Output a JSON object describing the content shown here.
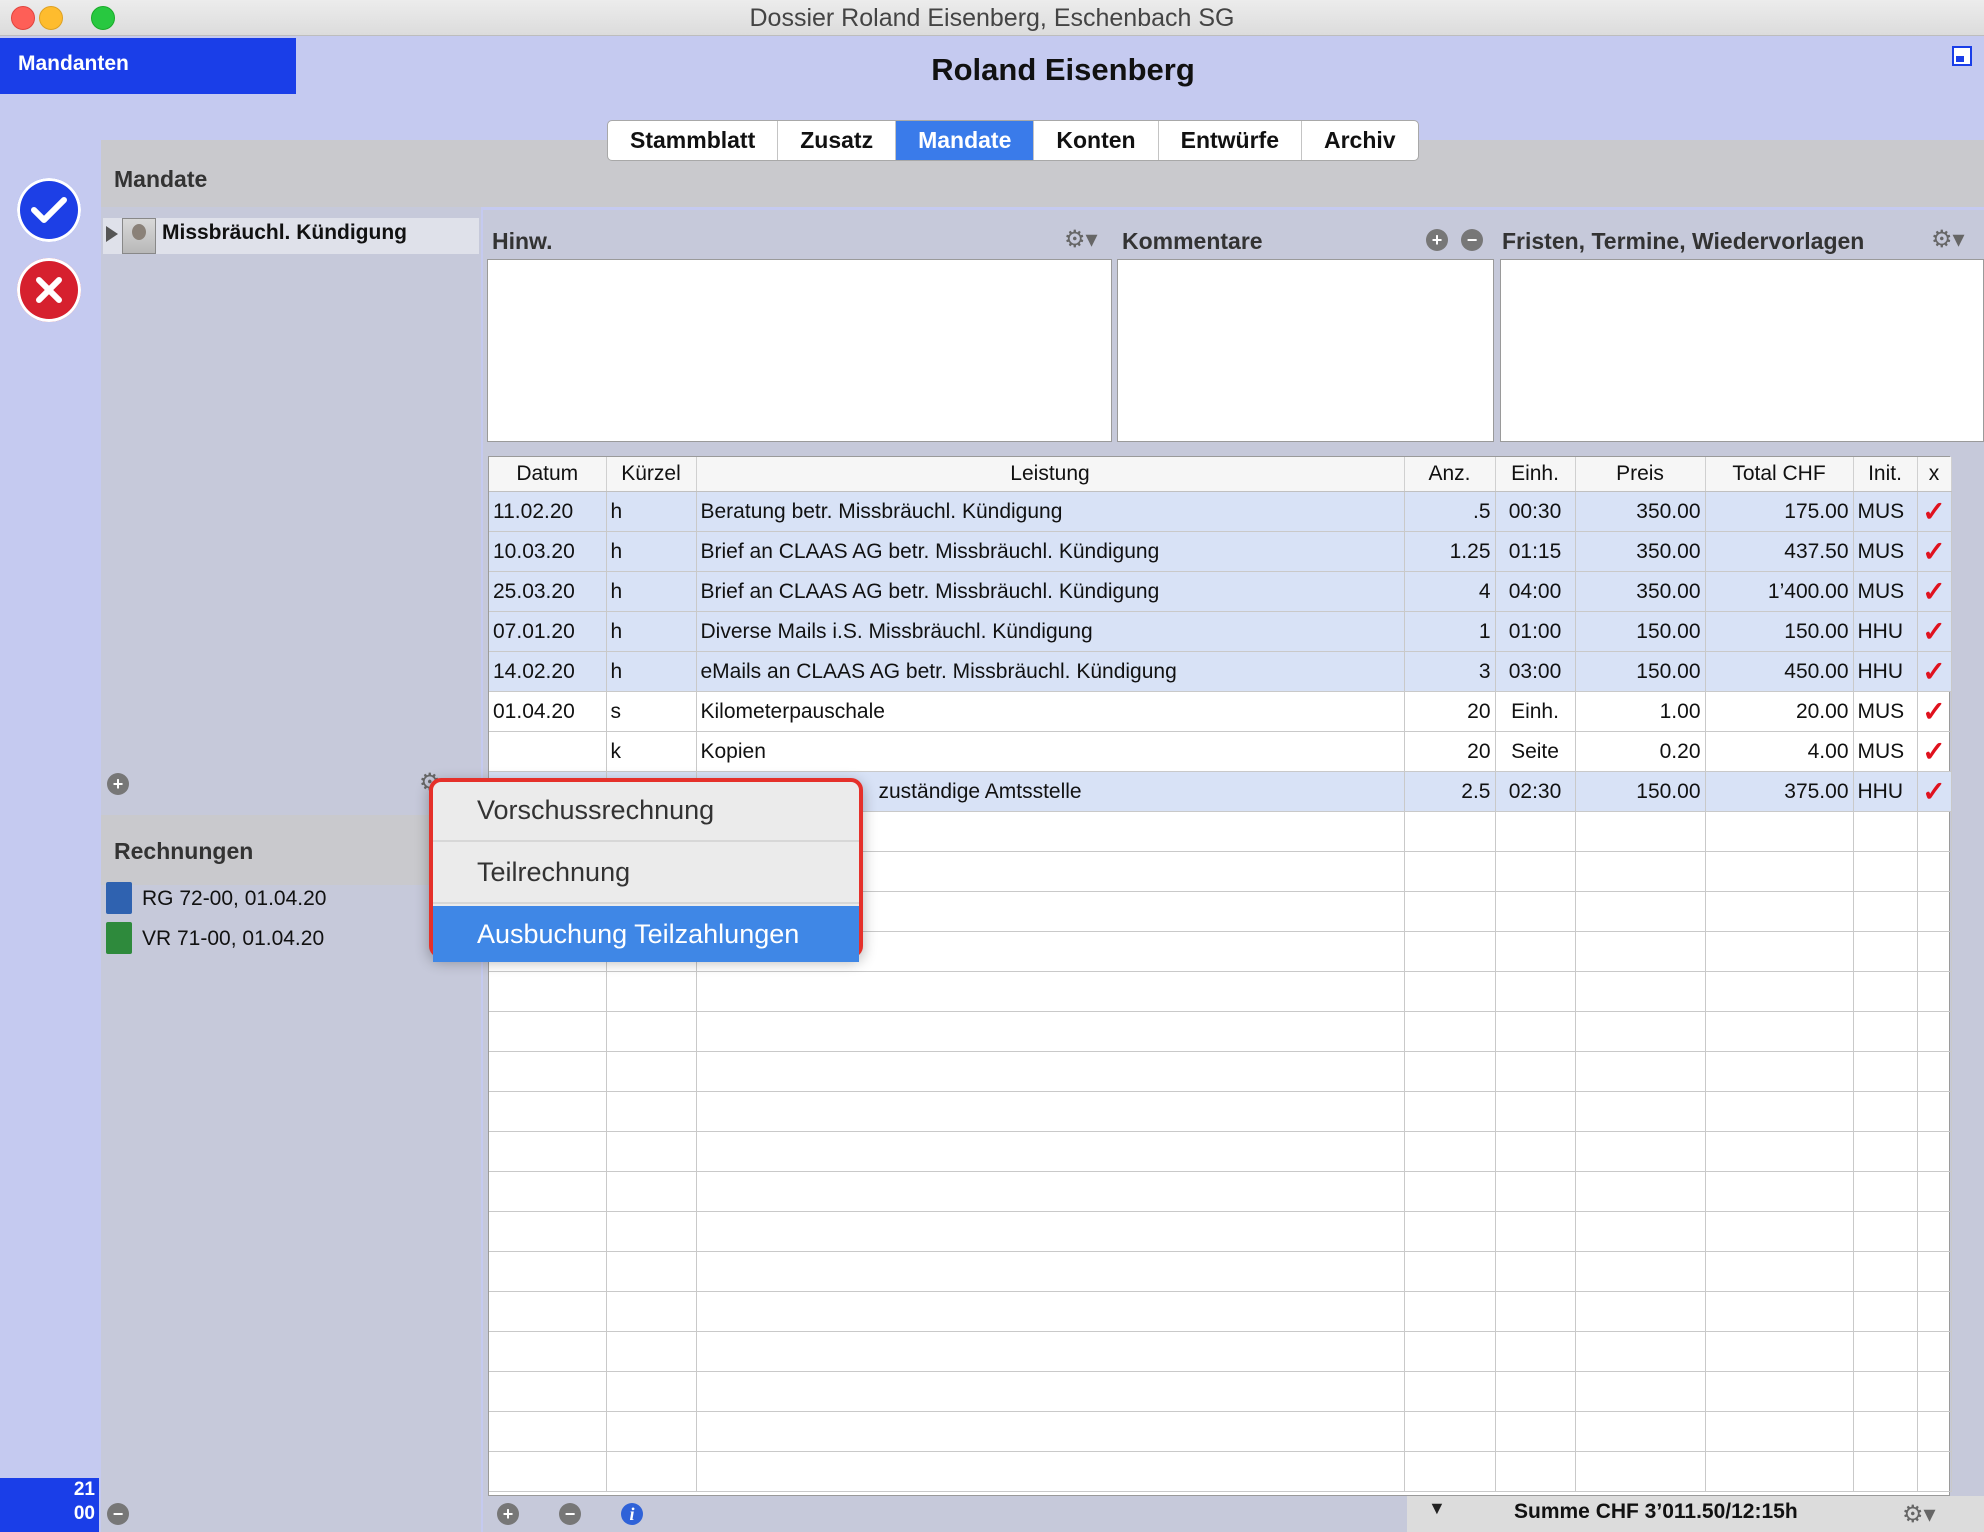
{
  "window": {
    "title": "Dossier Roland Eisenberg, Eschenbach SG"
  },
  "header": {
    "mandanten": "Mandanten",
    "client_name": "Roland Eisenberg"
  },
  "tabs": [
    {
      "label": "Stammblatt",
      "active": false
    },
    {
      "label": "Zusatz",
      "active": false
    },
    {
      "label": "Mandate",
      "active": true
    },
    {
      "label": "Konten",
      "active": false
    },
    {
      "label": "Entwürfe",
      "active": false
    },
    {
      "label": "Archiv",
      "active": false
    }
  ],
  "sidebar": {
    "mandate_title": "Mandate",
    "mandat_item": "Missbräuchl. Kündigung",
    "rechnungen_title": "Rechnungen",
    "invoices": [
      {
        "label": "RG 72-00, 01.04.20",
        "icon": "invoice-document-icon",
        "color": "#2f62b0"
      },
      {
        "label": "VR 71-00, 01.04.20",
        "icon": "advance-invoice-document-icon",
        "color": "#2e8a3c"
      }
    ],
    "badge_top": "21",
    "badge_bottom": "00"
  },
  "panels": {
    "hinweis": "Hinw.",
    "kommentare": "Kommentare",
    "fristen": "Fristen, Termine, Wiedervorlagen"
  },
  "table": {
    "headers": [
      "Datum",
      "Kürzel",
      "Leistung",
      "Anz.",
      "Einh.",
      "Preis",
      "Total CHF",
      "Init.",
      "x"
    ],
    "rows": [
      {
        "datum": "11.02.20",
        "kuerzel": "h",
        "leistung": "Beratung betr. Missbräuchl. Kündigung",
        "anz": ".5",
        "einh": "00:30",
        "preis": "350.00",
        "total": "175.00",
        "init": "MUS",
        "checked": true,
        "highlight": true
      },
      {
        "datum": "10.03.20",
        "kuerzel": "h",
        "leistung": "Brief an CLAAS AG betr. Missbräuchl. Kündigung",
        "anz": "1.25",
        "einh": "01:15",
        "preis": "350.00",
        "total": "437.50",
        "init": "MUS",
        "checked": true,
        "highlight": true
      },
      {
        "datum": "25.03.20",
        "kuerzel": "h",
        "leistung": "Brief an CLAAS AG betr. Missbräuchl. Kündigung",
        "anz": "4",
        "einh": "04:00",
        "preis": "350.00",
        "total": "1’400.00",
        "init": "MUS",
        "checked": true,
        "highlight": true
      },
      {
        "datum": "07.01.20",
        "kuerzel": "h",
        "leistung": "Diverse Mails i.S. Missbräuchl. Kündigung",
        "anz": "1",
        "einh": "01:00",
        "preis": "150.00",
        "total": "150.00",
        "init": "HHU",
        "checked": true,
        "highlight": true
      },
      {
        "datum": "14.02.20",
        "kuerzel": "h",
        "leistung": "eMails an CLAAS AG betr. Missbräuchl. Kündigung",
        "anz": "3",
        "einh": "03:00",
        "preis": "150.00",
        "total": "450.00",
        "init": "HHU",
        "checked": true,
        "highlight": true
      },
      {
        "datum": "01.04.20",
        "kuerzel": "s",
        "leistung": "Kilometerpauschale",
        "anz": "20",
        "einh": "Einh.",
        "preis": "1.00",
        "total": "20.00",
        "init": "MUS",
        "checked": true,
        "highlight": false
      },
      {
        "datum": "",
        "kuerzel": "k",
        "leistung": "Kopien",
        "anz": "20",
        "einh": "Seite",
        "preis": "0.20",
        "total": "4.00",
        "init": "MUS",
        "checked": true,
        "highlight": false
      },
      {
        "datum": "",
        "kuerzel": "",
        "leistung": "zuständige Amtsstelle",
        "anz": "2.5",
        "einh": "02:30",
        "preis": "150.00",
        "total": "375.00",
        "init": "HHU",
        "checked": true,
        "highlight": true
      }
    ],
    "empty_rows": 17
  },
  "footer": {
    "sum": "Summe CHF 3’011.50/12:15h"
  },
  "context_menu": {
    "items": [
      {
        "label": "Vorschussrechnung",
        "selected": false
      },
      {
        "label": "Teilrechnung",
        "selected": false
      },
      {
        "label": "Ausbuchung Teilzahlungen",
        "selected": true
      }
    ]
  },
  "colors": {
    "accent": "#1a3ee8",
    "background": "#c5caf0",
    "highlight_row": "#d8e2f6",
    "check": "#e0121e",
    "menu_selection": "#3f87e6",
    "menu_outline": "#e5302a"
  }
}
